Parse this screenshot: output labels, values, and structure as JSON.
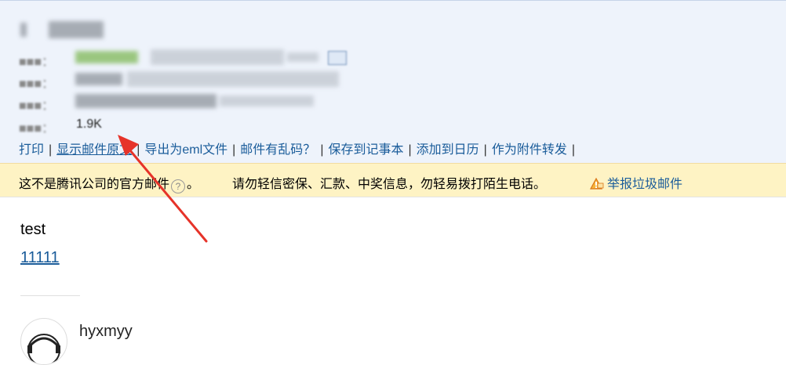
{
  "header": {
    "size_value": "1.9K"
  },
  "actions": {
    "items": [
      "打印",
      "显示邮件原文",
      "导出为eml文件",
      "邮件有乱码？",
      "保存到记事本",
      "添加到日历",
      "作为附件转发"
    ],
    "separator": "|"
  },
  "warning": {
    "notice": "这不是腾讯公司的官方邮件",
    "help_icon": "?",
    "tail": "。",
    "advice": "请勿轻信密保、汇款、中奖信息，勿轻易拨打陌生电话。",
    "report_label": "举报垃圾邮件"
  },
  "message": {
    "body_text": "test",
    "body_link": "11111"
  },
  "signature": {
    "name": "hyxmyy"
  },
  "colors": {
    "header_bg": "#eef3fb",
    "link": "#1a5c9a",
    "warning_bg": "#fef3c4",
    "annotation_arrow": "#e63329"
  },
  "icons": [
    "contact-card-icon",
    "help-circle-icon",
    "report-spam-icon",
    "avatar-image",
    "annotation-arrow"
  ]
}
